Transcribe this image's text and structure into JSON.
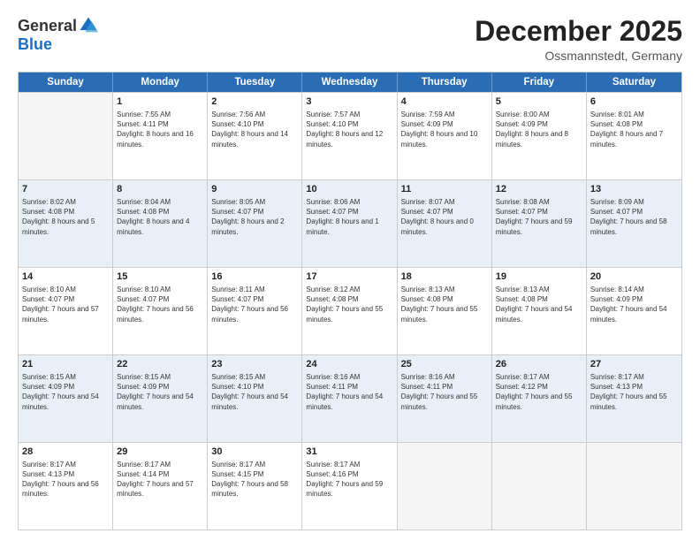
{
  "logo": {
    "general": "General",
    "blue": "Blue"
  },
  "title": "December 2025",
  "subtitle": "Ossmannstedt, Germany",
  "header_days": [
    "Sunday",
    "Monday",
    "Tuesday",
    "Wednesday",
    "Thursday",
    "Friday",
    "Saturday"
  ],
  "weeks": [
    [
      {
        "day": "",
        "sunrise": "",
        "sunset": "",
        "daylight": "",
        "empty": true
      },
      {
        "day": "1",
        "sunrise": "Sunrise: 7:55 AM",
        "sunset": "Sunset: 4:11 PM",
        "daylight": "Daylight: 8 hours and 16 minutes."
      },
      {
        "day": "2",
        "sunrise": "Sunrise: 7:56 AM",
        "sunset": "Sunset: 4:10 PM",
        "daylight": "Daylight: 8 hours and 14 minutes."
      },
      {
        "day": "3",
        "sunrise": "Sunrise: 7:57 AM",
        "sunset": "Sunset: 4:10 PM",
        "daylight": "Daylight: 8 hours and 12 minutes."
      },
      {
        "day": "4",
        "sunrise": "Sunrise: 7:59 AM",
        "sunset": "Sunset: 4:09 PM",
        "daylight": "Daylight: 8 hours and 10 minutes."
      },
      {
        "day": "5",
        "sunrise": "Sunrise: 8:00 AM",
        "sunset": "Sunset: 4:09 PM",
        "daylight": "Daylight: 8 hours and 8 minutes."
      },
      {
        "day": "6",
        "sunrise": "Sunrise: 8:01 AM",
        "sunset": "Sunset: 4:08 PM",
        "daylight": "Daylight: 8 hours and 7 minutes."
      }
    ],
    [
      {
        "day": "7",
        "sunrise": "Sunrise: 8:02 AM",
        "sunset": "Sunset: 4:08 PM",
        "daylight": "Daylight: 8 hours and 5 minutes."
      },
      {
        "day": "8",
        "sunrise": "Sunrise: 8:04 AM",
        "sunset": "Sunset: 4:08 PM",
        "daylight": "Daylight: 8 hours and 4 minutes."
      },
      {
        "day": "9",
        "sunrise": "Sunrise: 8:05 AM",
        "sunset": "Sunset: 4:07 PM",
        "daylight": "Daylight: 8 hours and 2 minutes."
      },
      {
        "day": "10",
        "sunrise": "Sunrise: 8:06 AM",
        "sunset": "Sunset: 4:07 PM",
        "daylight": "Daylight: 8 hours and 1 minute."
      },
      {
        "day": "11",
        "sunrise": "Sunrise: 8:07 AM",
        "sunset": "Sunset: 4:07 PM",
        "daylight": "Daylight: 8 hours and 0 minutes."
      },
      {
        "day": "12",
        "sunrise": "Sunrise: 8:08 AM",
        "sunset": "Sunset: 4:07 PM",
        "daylight": "Daylight: 7 hours and 59 minutes."
      },
      {
        "day": "13",
        "sunrise": "Sunrise: 8:09 AM",
        "sunset": "Sunset: 4:07 PM",
        "daylight": "Daylight: 7 hours and 58 minutes."
      }
    ],
    [
      {
        "day": "14",
        "sunrise": "Sunrise: 8:10 AM",
        "sunset": "Sunset: 4:07 PM",
        "daylight": "Daylight: 7 hours and 57 minutes."
      },
      {
        "day": "15",
        "sunrise": "Sunrise: 8:10 AM",
        "sunset": "Sunset: 4:07 PM",
        "daylight": "Daylight: 7 hours and 56 minutes."
      },
      {
        "day": "16",
        "sunrise": "Sunrise: 8:11 AM",
        "sunset": "Sunset: 4:07 PM",
        "daylight": "Daylight: 7 hours and 56 minutes."
      },
      {
        "day": "17",
        "sunrise": "Sunrise: 8:12 AM",
        "sunset": "Sunset: 4:08 PM",
        "daylight": "Daylight: 7 hours and 55 minutes."
      },
      {
        "day": "18",
        "sunrise": "Sunrise: 8:13 AM",
        "sunset": "Sunset: 4:08 PM",
        "daylight": "Daylight: 7 hours and 55 minutes."
      },
      {
        "day": "19",
        "sunrise": "Sunrise: 8:13 AM",
        "sunset": "Sunset: 4:08 PM",
        "daylight": "Daylight: 7 hours and 54 minutes."
      },
      {
        "day": "20",
        "sunrise": "Sunrise: 8:14 AM",
        "sunset": "Sunset: 4:09 PM",
        "daylight": "Daylight: 7 hours and 54 minutes."
      }
    ],
    [
      {
        "day": "21",
        "sunrise": "Sunrise: 8:15 AM",
        "sunset": "Sunset: 4:09 PM",
        "daylight": "Daylight: 7 hours and 54 minutes."
      },
      {
        "day": "22",
        "sunrise": "Sunrise: 8:15 AM",
        "sunset": "Sunset: 4:09 PM",
        "daylight": "Daylight: 7 hours and 54 minutes."
      },
      {
        "day": "23",
        "sunrise": "Sunrise: 8:15 AM",
        "sunset": "Sunset: 4:10 PM",
        "daylight": "Daylight: 7 hours and 54 minutes."
      },
      {
        "day": "24",
        "sunrise": "Sunrise: 8:16 AM",
        "sunset": "Sunset: 4:11 PM",
        "daylight": "Daylight: 7 hours and 54 minutes."
      },
      {
        "day": "25",
        "sunrise": "Sunrise: 8:16 AM",
        "sunset": "Sunset: 4:11 PM",
        "daylight": "Daylight: 7 hours and 55 minutes."
      },
      {
        "day": "26",
        "sunrise": "Sunrise: 8:17 AM",
        "sunset": "Sunset: 4:12 PM",
        "daylight": "Daylight: 7 hours and 55 minutes."
      },
      {
        "day": "27",
        "sunrise": "Sunrise: 8:17 AM",
        "sunset": "Sunset: 4:13 PM",
        "daylight": "Daylight: 7 hours and 55 minutes."
      }
    ],
    [
      {
        "day": "28",
        "sunrise": "Sunrise: 8:17 AM",
        "sunset": "Sunset: 4:13 PM",
        "daylight": "Daylight: 7 hours and 56 minutes."
      },
      {
        "day": "29",
        "sunrise": "Sunrise: 8:17 AM",
        "sunset": "Sunset: 4:14 PM",
        "daylight": "Daylight: 7 hours and 57 minutes."
      },
      {
        "day": "30",
        "sunrise": "Sunrise: 8:17 AM",
        "sunset": "Sunset: 4:15 PM",
        "daylight": "Daylight: 7 hours and 58 minutes."
      },
      {
        "day": "31",
        "sunrise": "Sunrise: 8:17 AM",
        "sunset": "Sunset: 4:16 PM",
        "daylight": "Daylight: 7 hours and 59 minutes."
      },
      {
        "day": "",
        "sunrise": "",
        "sunset": "",
        "daylight": "",
        "empty": true
      },
      {
        "day": "",
        "sunrise": "",
        "sunset": "",
        "daylight": "",
        "empty": true
      },
      {
        "day": "",
        "sunrise": "",
        "sunset": "",
        "daylight": "",
        "empty": true
      }
    ]
  ]
}
